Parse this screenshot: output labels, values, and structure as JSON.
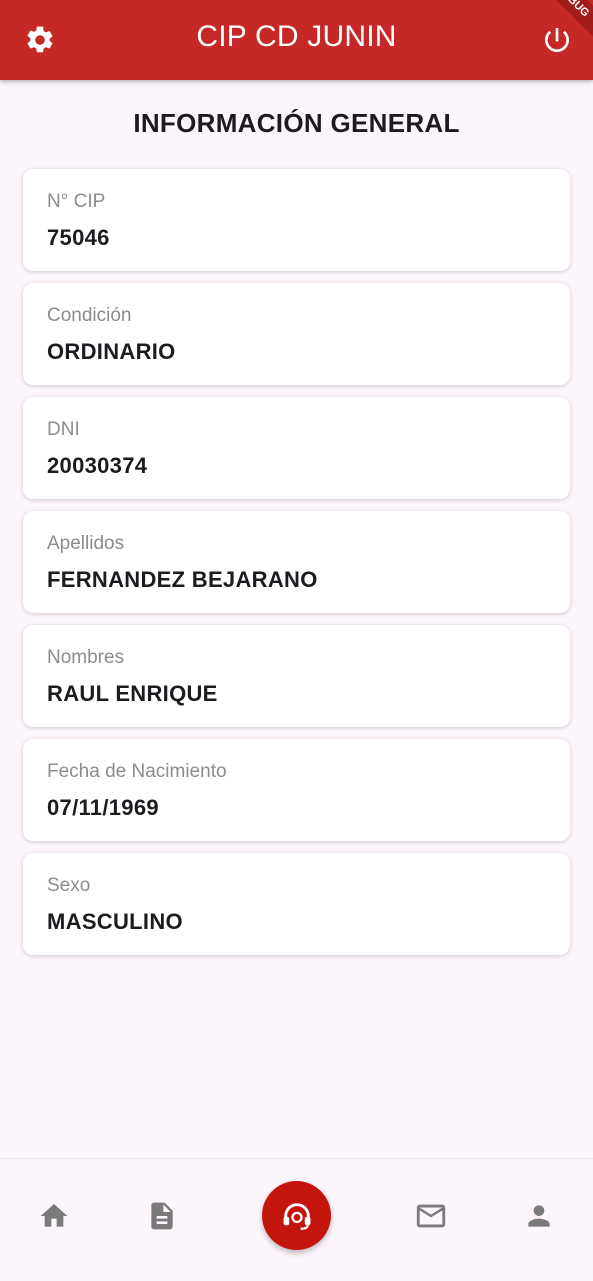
{
  "app_bar": {
    "title": "CIP CD JUNIN",
    "debug_banner": "DEBUG",
    "color": "#c62828",
    "left_icon": "gear-icon",
    "right_icon": "power-icon"
  },
  "page": {
    "title": "INFORMACIÓN GENERAL"
  },
  "fields": [
    {
      "label": "N° CIP",
      "value": "75046"
    },
    {
      "label": "Condición",
      "value": "ORDINARIO"
    },
    {
      "label": "DNI",
      "value": "20030374"
    },
    {
      "label": "Apellidos",
      "value": "FERNANDEZ BEJARANO"
    },
    {
      "label": "Nombres",
      "value": "RAUL ENRIQUE"
    },
    {
      "label": "Fecha de Nacimiento",
      "value": "07/11/1969"
    },
    {
      "label": "Sexo",
      "value": "MASCULINO"
    }
  ],
  "bottom_nav": {
    "items": [
      "home-icon",
      "document-icon",
      "support-icon",
      "mail-icon",
      "person-icon"
    ],
    "active_color": "#c4150c",
    "icon_color": "#7a7a7a"
  }
}
